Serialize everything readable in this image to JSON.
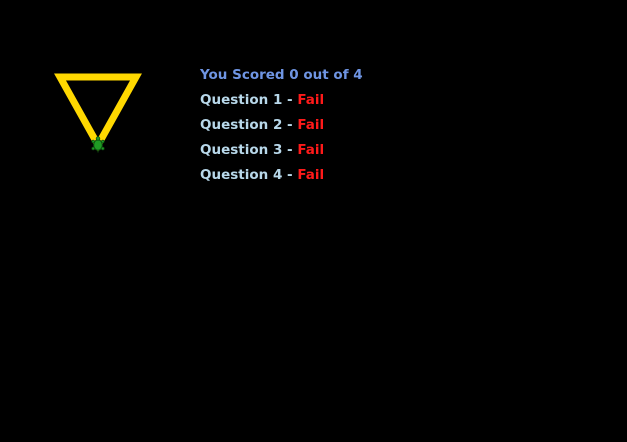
{
  "app": {
    "background": "#000000"
  },
  "drawing": {
    "shape": "inverted-triangle",
    "stroke_color": "#ffd800",
    "turtle_icon": "turtle-icon",
    "turtle_color": "#1f9a24"
  },
  "score": {
    "text": "You Scored 0 out of 4",
    "color": "#6f95e3"
  },
  "questions": [
    {
      "label": "Question 1",
      "separator": "-",
      "result": "Fail"
    },
    {
      "label": "Question 2",
      "separator": "-",
      "result": "Fail"
    },
    {
      "label": "Question 3",
      "separator": "-",
      "result": "Fail"
    },
    {
      "label": "Question 4",
      "separator": "-",
      "result": "Fail"
    }
  ],
  "colors": {
    "question": "#b8d8ea",
    "fail": "#ff1a1a"
  }
}
